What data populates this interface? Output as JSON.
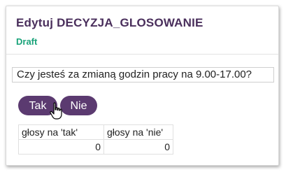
{
  "header": {
    "title": "Edytuj DECYZJA_GLOSOWANIE",
    "status": "Draft"
  },
  "question": {
    "text": "Czy jesteś za zmianą godzin pracy na 9.00-17.00?"
  },
  "buttons": {
    "yes_label": "Tak",
    "no_label": "Nie"
  },
  "votes": {
    "headers": [
      "głosy na 'tak'",
      "głosy na 'nie'"
    ],
    "values": [
      "0",
      "0"
    ]
  },
  "colors": {
    "title": "#4a2f5c",
    "status": "#1aa37a",
    "button": "#5b3a70"
  },
  "cursor": {
    "icon": "hand-pointer-icon"
  }
}
